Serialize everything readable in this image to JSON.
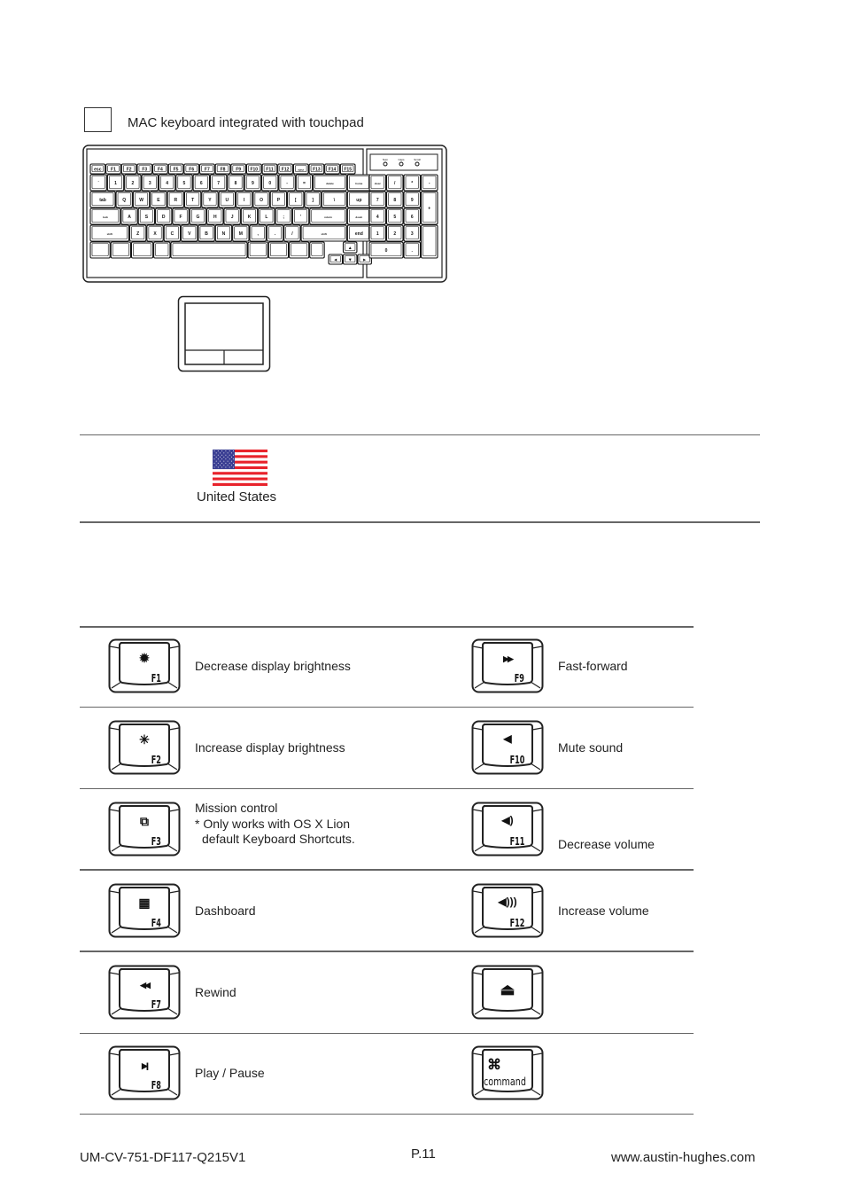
{
  "section": {
    "checkbox_checked": false,
    "heading": "MAC keyboard integrated with touchpad"
  },
  "keyboard_diagram": {
    "indicators": [
      "Num",
      "Caps",
      "Scroll"
    ],
    "function_row": [
      "esc",
      "F1",
      "F2",
      "F3",
      "F4",
      "F5",
      "F6",
      "F7",
      "F8",
      "F9",
      "F10",
      "F11",
      "F12",
      "eject",
      "F13",
      "F14",
      "F15"
    ],
    "number_row": [
      "~ `",
      "! 1",
      "@ 2",
      "# 3",
      "$ 4",
      "% 5",
      "^ 6",
      "& 7",
      "* 8",
      "( 9",
      ") 0",
      "_ -",
      "+ =",
      "delete",
      "home"
    ],
    "qwerty_row": [
      "tab",
      "Q",
      "W",
      "E",
      "R",
      "T",
      "Y",
      "U",
      "I",
      "O",
      "P",
      "{ [",
      "} ]",
      "| \\",
      "page up"
    ],
    "home_row": [
      "caps lock",
      "A",
      "S",
      "D",
      "F",
      "G",
      "H",
      "J",
      "K",
      "L",
      ": ;",
      "\" '",
      "return",
      "page down"
    ],
    "shift_row": [
      "shift",
      "Z",
      "X",
      "C",
      "V",
      "B",
      "N",
      "M",
      "< ,",
      "> .",
      "? /",
      "shift",
      "end"
    ],
    "bottom_row": [
      "control",
      "option",
      "command",
      "| \\",
      "space",
      "command",
      "option",
      "control",
      "fn"
    ],
    "arrows": [
      "▲",
      "◄",
      "▼",
      "►"
    ],
    "numpad": [
      "clear",
      "/",
      "*",
      "-",
      "7",
      "8",
      "9",
      "+",
      "4",
      "5",
      "6",
      "1",
      "2",
      "3",
      "enter",
      "0",
      "."
    ]
  },
  "layout": {
    "country": "United States",
    "flag_colors": {
      "red": "#e8232b",
      "white": "#ffffff",
      "blue": "#3b3f93"
    }
  },
  "hotkeys": [
    {
      "key": "F1",
      "glyph": "✹",
      "icon": "brightness-down-icon",
      "description": "Decrease display brightness"
    },
    {
      "key": "F9",
      "glyph": "▶▶",
      "icon": "fast-forward-icon",
      "description": "Fast-forward"
    },
    {
      "key": "F2",
      "glyph": "✳",
      "icon": "brightness-up-icon",
      "description": "Increase display brightness"
    },
    {
      "key": "F10",
      "glyph": "◀",
      "icon": "mute-icon",
      "description": "Mute sound"
    },
    {
      "key": "F3",
      "glyph": "⧉",
      "icon": "mission-control-icon",
      "description": "Mission control",
      "note_line1": "* Only works with OS X Lion",
      "note_line2": "default Keyboard Shortcuts."
    },
    {
      "key": "F11",
      "glyph": "◀)",
      "icon": "volume-down-icon",
      "description": "Decrease volume"
    },
    {
      "key": "F4",
      "glyph": "▦",
      "icon": "dashboard-icon",
      "description": "Dashboard"
    },
    {
      "key": "F12",
      "glyph": "◀)))",
      "icon": "volume-up-icon",
      "description": "Increase volume"
    },
    {
      "key": "F7",
      "glyph": "◀◀",
      "icon": "rewind-icon",
      "description": "Rewind"
    },
    {
      "key": "",
      "glyph": "⏏",
      "icon": "eject-icon",
      "description": ""
    },
    {
      "key": "F8",
      "glyph": "▶||",
      "icon": "play-pause-icon",
      "description": "Play / Pause"
    },
    {
      "key": "command",
      "glyph": "⌘",
      "icon": "command-icon",
      "description": ""
    }
  ],
  "footer": {
    "doc_code": "UM-CV-751-DF117-Q215V1",
    "page": "P.11",
    "website": "www.austin-hughes.com"
  }
}
